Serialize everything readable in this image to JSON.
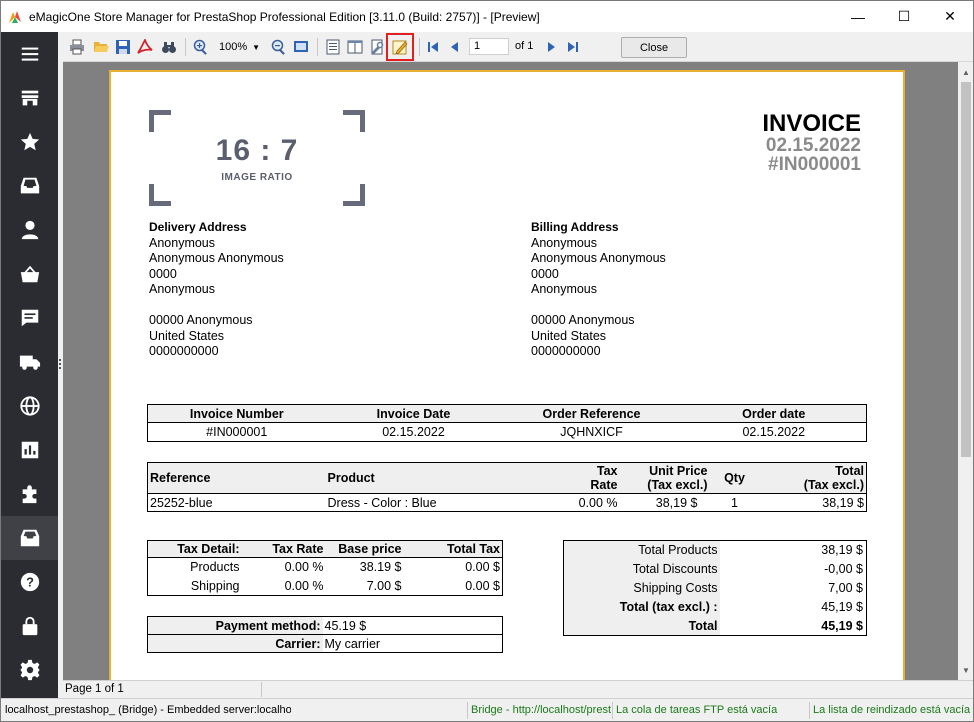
{
  "window": {
    "title": "eMagicOne Store Manager for PrestaShop Professional Edition [3.11.0 (Build: 2757)] - [Preview]",
    "controls": {
      "minimize": "—",
      "maximize": "☐",
      "close": "✕"
    }
  },
  "sidebar": {
    "items": [
      {
        "icon": "menu-icon"
      },
      {
        "icon": "store-icon"
      },
      {
        "icon": "star-icon"
      },
      {
        "icon": "inbox-icon"
      },
      {
        "icon": "user-icon"
      },
      {
        "icon": "basket-icon"
      },
      {
        "icon": "comment-icon"
      },
      {
        "icon": "truck-icon"
      },
      {
        "icon": "globe-icon"
      },
      {
        "icon": "chart-icon"
      },
      {
        "icon": "puzzle-icon"
      },
      {
        "icon": "archive-icon",
        "active": true
      },
      {
        "icon": "help-icon"
      },
      {
        "icon": "lock-icon"
      },
      {
        "icon": "gear-icon"
      }
    ]
  },
  "toolbar": {
    "zoom": "100%",
    "page_current": "1",
    "page_of": "of 1",
    "close_label": "Close"
  },
  "invoice": {
    "logo": {
      "ratio": "16 : 7",
      "caption": "IMAGE RATIO"
    },
    "title": "INVOICE",
    "date": "02.15.2022",
    "number": "#IN000001",
    "delivery": {
      "heading": "Delivery Address",
      "lines": [
        "Anonymous",
        "Anonymous Anonymous",
        "0000",
        "Anonymous",
        "",
        "00000 Anonymous",
        "United States",
        "0000000000"
      ]
    },
    "billing": {
      "heading": "Billing Address",
      "lines": [
        "Anonymous",
        "Anonymous Anonymous",
        "0000",
        "Anonymous",
        "",
        "00000 Anonymous",
        "United States",
        "0000000000"
      ]
    },
    "info_table": {
      "headers": [
        "Invoice Number",
        "Invoice Date",
        "Order Reference",
        "Order date"
      ],
      "row": [
        "#IN000001",
        "02.15.2022",
        "JQHNXICF",
        "02.15.2022"
      ]
    },
    "product_table": {
      "headers": {
        "reference": "Reference",
        "product": "Product",
        "tax_rate_1": "Tax",
        "tax_rate_2": "Rate",
        "unit_price_1": "Unit Price",
        "unit_price_2": "(Tax excl.)",
        "qty": "Qty",
        "total_1": "Total",
        "total_2": "(Tax excl.)"
      },
      "row": {
        "reference": "25252-blue",
        "product": "Dress - Color : Blue",
        "tax_rate": "0.00 %",
        "unit_price": "38,19 $",
        "qty": "1",
        "total": "38,19 $"
      }
    },
    "tax_table": {
      "headers": [
        "Tax Detail:",
        "Tax Rate",
        "Base price",
        "Total Tax"
      ],
      "rows": [
        [
          "Products",
          "0.00 %",
          "38.19 $",
          "0.00 $"
        ],
        [
          "Shipping",
          "0.00 %",
          "7.00 $",
          "0.00 $"
        ]
      ]
    },
    "totals": [
      {
        "label": "Total Products",
        "value": "38,19 $"
      },
      {
        "label": "Total Discounts",
        "value": "-0,00 $"
      },
      {
        "label": "Shipping Costs",
        "value": "7,00 $"
      },
      {
        "label": "Total (tax excl.) :",
        "value": "45,19 $"
      },
      {
        "label": "Total",
        "value": "45,19 $"
      }
    ],
    "payment": {
      "method_label": "Payment method:",
      "method_value": "45.19 $",
      "carrier_label": "Carrier:",
      "carrier_value": "My carrier"
    }
  },
  "page_status": "Page 1 of 1",
  "status_bar": {
    "connection": "localhost_prestashop_ (Bridge) - Embedded server:localhost",
    "bridge": "Bridge - http://localhost/prestashop",
    "ftp": "La cola de tareas FTP está vacía",
    "reindex": "La lista de reindizado está vacía"
  }
}
